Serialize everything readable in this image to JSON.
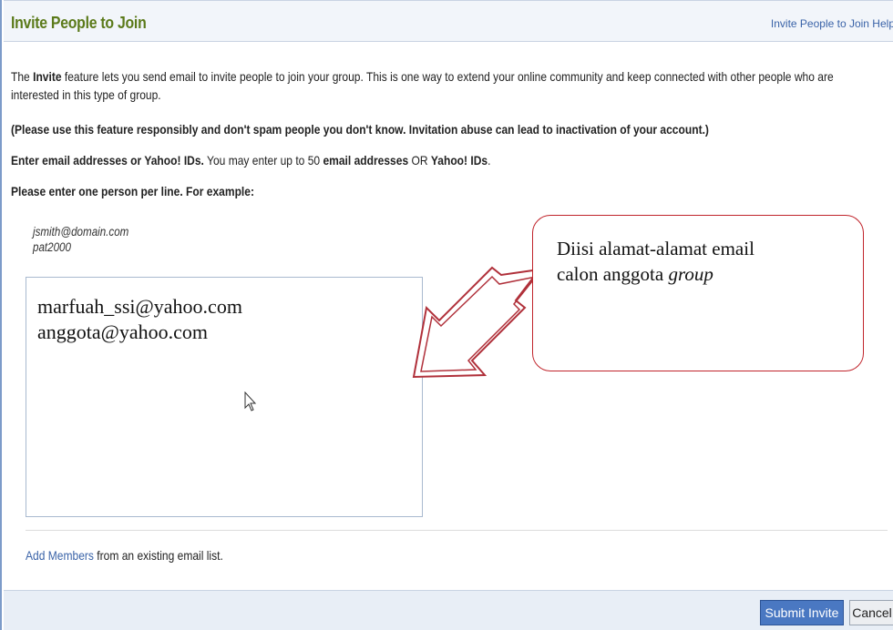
{
  "header": {
    "title": "Invite People to Join",
    "help_link": "Invite People to Join Help"
  },
  "intro": {
    "pre": "The ",
    "bold": "Invite",
    "post": " feature lets you send email to invite people to join your group. This is one way to extend your online community and keep connected with other people who are interested in this type of group."
  },
  "warning": "(Please use this feature responsibly and don't spam people you don't know. Invitation abuse can lead to inactivation of your account.)",
  "instruction": {
    "bold1": "Enter email addresses or Yahoo! IDs.",
    "text1": " You may enter up to 50 ",
    "bold2": "email addresses",
    "text2": " OR ",
    "bold3": "Yahoo! IDs",
    "text3": "."
  },
  "per_line": "Please enter one person per line. For example:",
  "examples": [
    "jsmith@domain.com",
    "pat2000"
  ],
  "textarea": {
    "lines": [
      "marfuah_ssi@yahoo.com",
      "anggota@yahoo.com"
    ]
  },
  "add_members": {
    "link": "Add Members",
    "text": " from an existing email list."
  },
  "buttons": {
    "submit": "Submit Invite",
    "cancel": "Cancel"
  },
  "callout": {
    "line1": "Diisi alamat-alamat email",
    "line2_plain": "calon anggota ",
    "line2_italic": "group"
  },
  "colors": {
    "title": "#5b7a1a",
    "link": "#3a63a8",
    "submit_bg": "#4a78c2",
    "callout_border": "#c0242b",
    "arrow_border": "#b0303a"
  }
}
